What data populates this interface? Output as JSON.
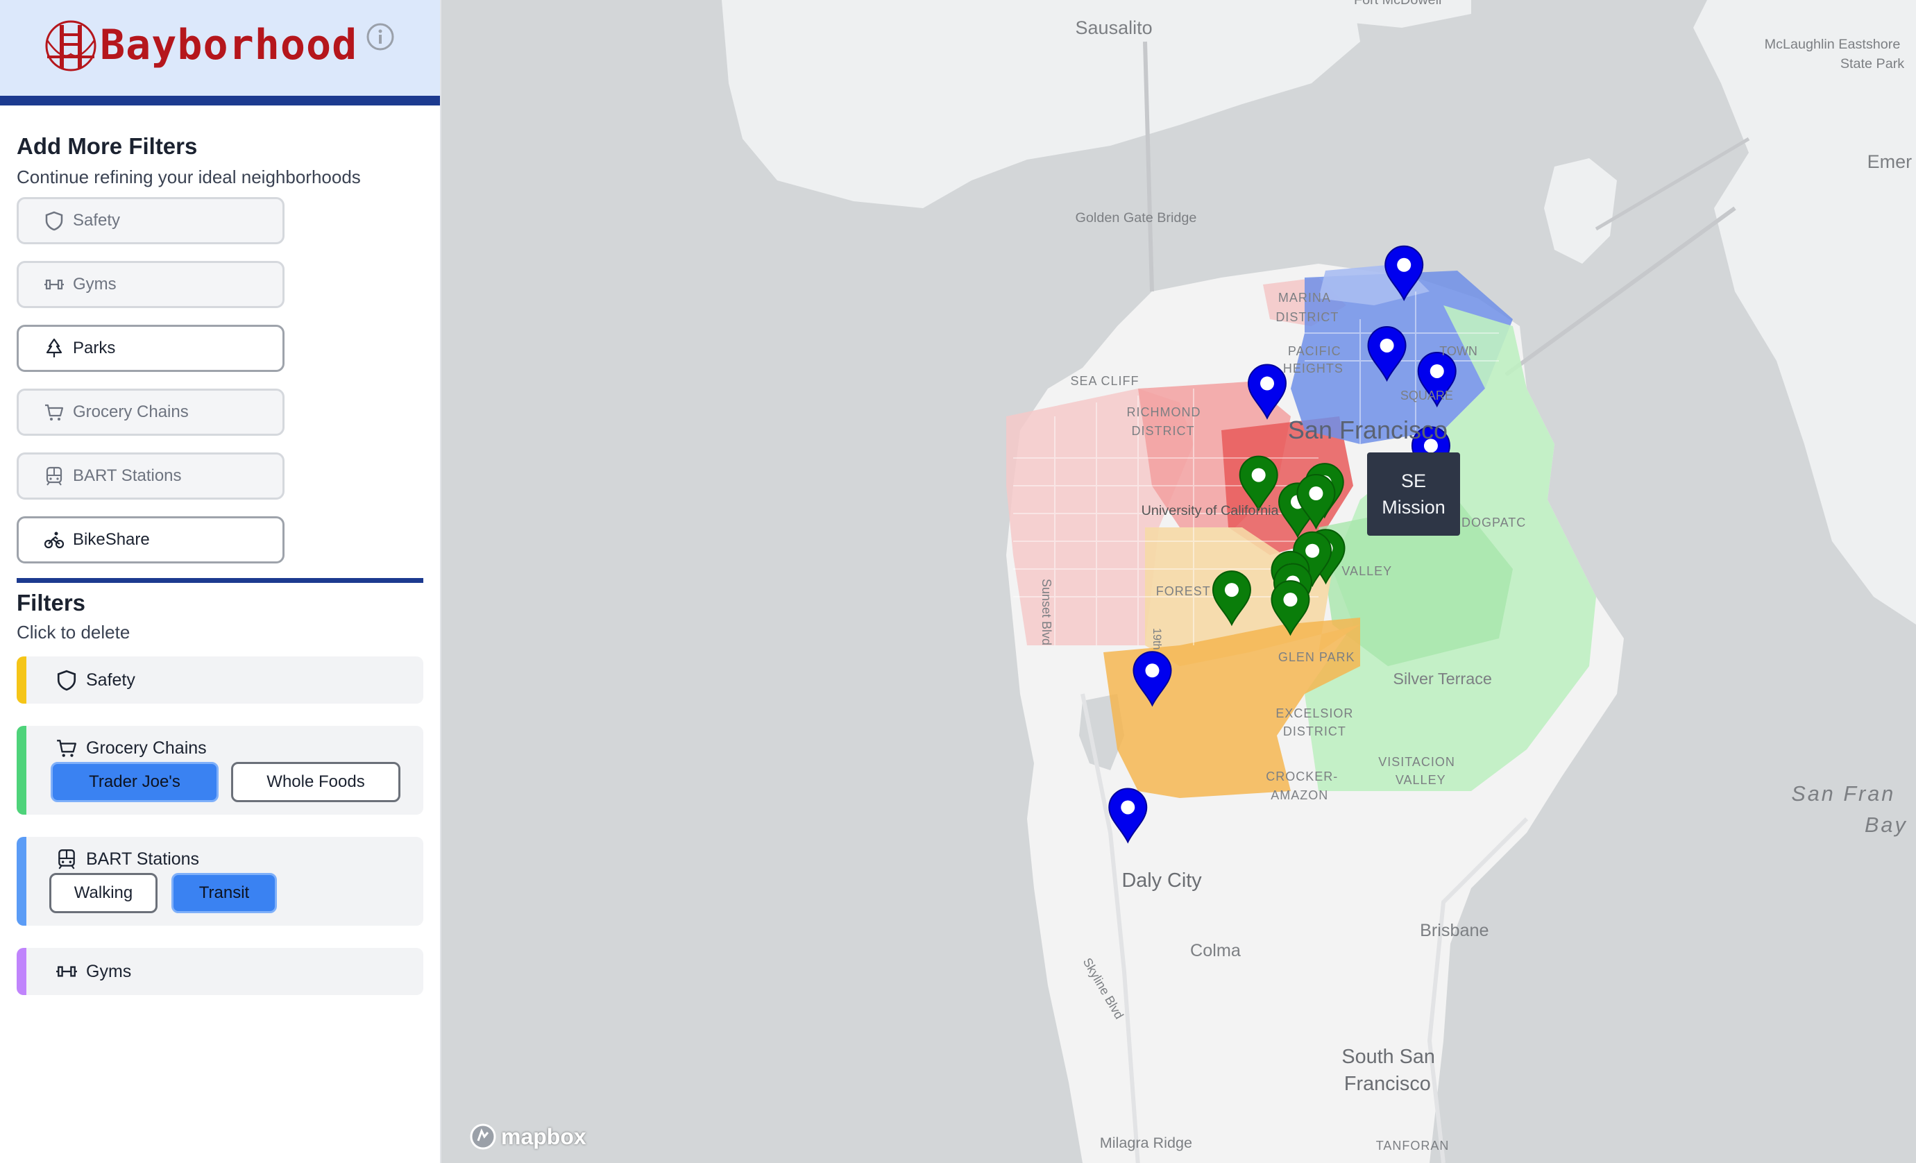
{
  "app": {
    "title": "Bayborhood"
  },
  "add_filters": {
    "title": "Add More Filters",
    "subtitle": "Continue refining your ideal neighborhoods",
    "buttons": [
      {
        "label": "Safety",
        "icon": "shield-icon",
        "enabled": false
      },
      {
        "label": "Gyms",
        "icon": "dumbbell-icon",
        "enabled": false
      },
      {
        "label": "Parks",
        "icon": "tree-icon",
        "enabled": true
      },
      {
        "label": "Grocery Chains",
        "icon": "cart-icon",
        "enabled": false
      },
      {
        "label": "BART Stations",
        "icon": "train-icon",
        "enabled": false
      },
      {
        "label": "BikeShare",
        "icon": "bike-icon",
        "enabled": true
      }
    ]
  },
  "filters": {
    "title": "Filters",
    "subtitle": "Click to delete",
    "cards": [
      {
        "label": "Safety",
        "icon": "shield-icon",
        "color": "#f5c518"
      },
      {
        "label": "Grocery Chains",
        "icon": "cart-icon",
        "color": "#4ed37a",
        "options": [
          {
            "label": "Trader Joe's",
            "selected": true
          },
          {
            "label": "Whole Foods",
            "selected": false
          }
        ]
      },
      {
        "label": "BART Stations",
        "icon": "train-icon",
        "color": "#5b9cf6",
        "options": [
          {
            "label": "Walking",
            "selected": false
          },
          {
            "label": "Transit",
            "selected": true
          }
        ]
      },
      {
        "label": "Gyms",
        "icon": "dumbbell-icon",
        "color": "#c084fc"
      }
    ]
  },
  "map": {
    "labels": {
      "sausalito": "Sausalito",
      "fort_mcdowell": "Fort McDowell",
      "mclaughlin_1": "McLaughlin Eastshore",
      "mclaughlin_2": "State Park",
      "emeryville": "Emer",
      "golden_gate_bridge": "Golden Gate Bridge",
      "marina_1": "MARINA",
      "marina_2": "DISTRICT",
      "pacific_1": "PACIFIC",
      "pacific_2": "HEIGHTS",
      "sea_cliff": "SEA CLIFF",
      "richmond_1": "RICHMOND",
      "richmond_2": "DISTRICT",
      "chinatown": "TOWN",
      "union_square": "SQUARE",
      "san_francisco": "San Francisco",
      "ucsf": "University of California",
      "dogpatch": "DOGPATC",
      "valley": "VALLEY",
      "forest": "FOREST",
      "sunset_blvd": "Sunset Blvd",
      "nineteenth": "19th",
      "glen_park": "GLEN PARK",
      "silver_terrace": "Silver Terrace",
      "excelsior_1": "EXCELSIOR",
      "excelsior_2": "DISTRICT",
      "visitacion_1": "VISITACION",
      "visitacion_2": "VALLEY",
      "crocker_1": "CROCKER-",
      "crocker_2": "AMAZON",
      "sf_bay_1": "San Fran",
      "sf_bay_2": "Bay",
      "daly_city": "Daly City",
      "colma": "Colma",
      "brisbane": "Brisbane",
      "skyline_blvd": "Skyline Blvd",
      "south_sf_1": "South San",
      "south_sf_2": "Francisco",
      "milagra_ridge": "Milagra Ridge",
      "tanforan": "TANFORAN"
    },
    "tooltip": {
      "line1": "SE",
      "line2": "Mission"
    },
    "attribution": "mapbox",
    "marker_colors": {
      "blue": "#0000ee",
      "green": "#0a7d0a"
    }
  }
}
